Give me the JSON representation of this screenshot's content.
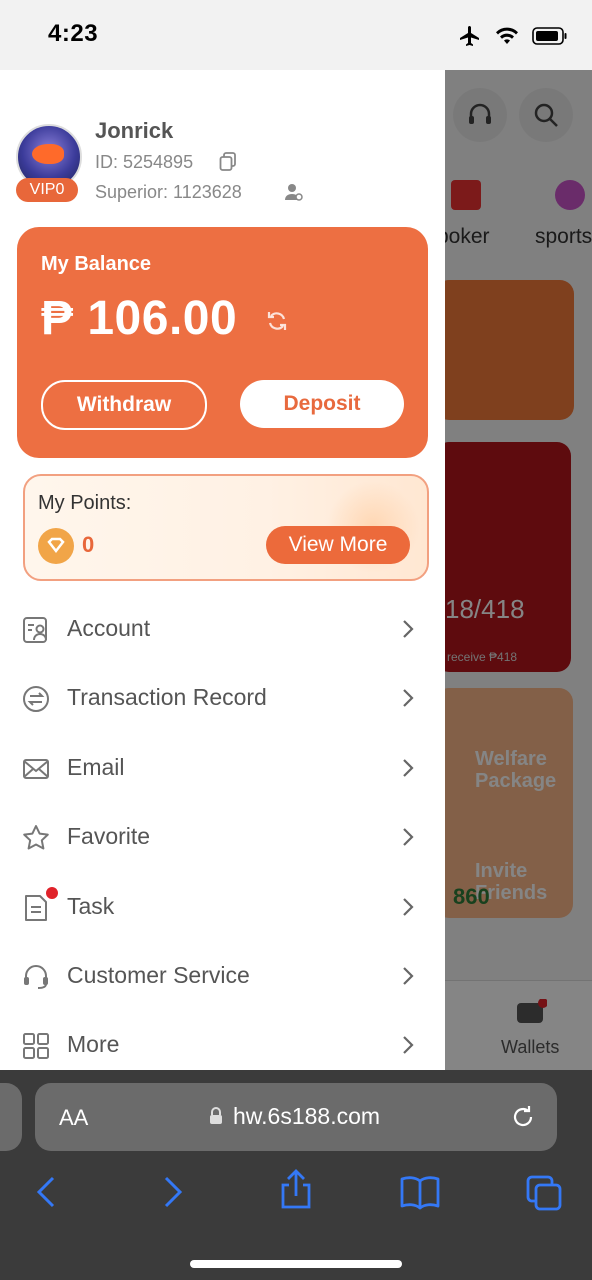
{
  "status_bar": {
    "time": "4:23"
  },
  "background_page": {
    "categories": [
      "poker",
      "sports"
    ],
    "promo_values": [
      "18/418",
      "receive ₱418",
      "860"
    ],
    "promo_labels": [
      "Welfare Package",
      "Invite Friends"
    ],
    "tabbar_label": "Wallets"
  },
  "profile": {
    "username": "Jonrick",
    "id_text": "ID: 5254895",
    "superior_text": "Superior:  1123628",
    "vip_label": "VIP0"
  },
  "balance": {
    "title": "My Balance",
    "amount": "₱ 106.00",
    "withdraw_label": "Withdraw",
    "deposit_label": "Deposit"
  },
  "points": {
    "title": "My Points:",
    "value": "0",
    "view_more_label": "View More"
  },
  "menu": {
    "items": [
      {
        "label": "Account",
        "icon": "account-icon"
      },
      {
        "label": "Transaction Record",
        "icon": "transaction-icon"
      },
      {
        "label": "Email",
        "icon": "email-icon"
      },
      {
        "label": "Favorite",
        "icon": "star-icon"
      },
      {
        "label": "Task",
        "icon": "task-icon"
      },
      {
        "label": "Customer Service",
        "icon": "headset-icon"
      },
      {
        "label": "More",
        "icon": "grid-icon"
      }
    ]
  },
  "browser": {
    "aa_label": "AA",
    "url": "hw.6s188.com"
  },
  "colors": {
    "accent": "#ed6f42",
    "browser_chrome": "#3b3b3b",
    "link_blue": "#3478f6"
  }
}
